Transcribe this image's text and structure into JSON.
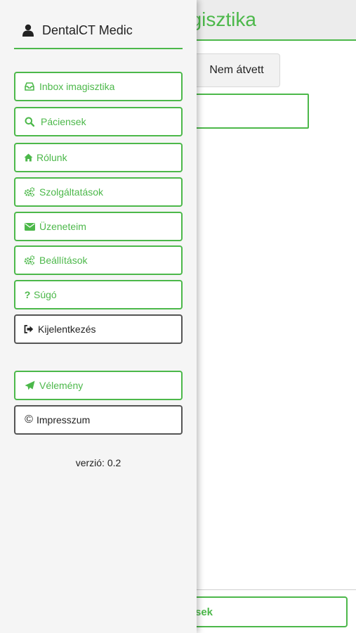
{
  "page": {
    "title_partial": "agisztika",
    "filter_button": "Nem átvett",
    "bottom_button_partial": "sek"
  },
  "drawer": {
    "app_name": "DentalCT Medic",
    "user_icon": "user-icon",
    "menu": [
      {
        "label": "Inbox imagisztika",
        "icon": "inbox-icon"
      },
      {
        "label": "Páciensek",
        "icon": "search-icon"
      },
      {
        "label": "Rólunk",
        "icon": "home-icon"
      },
      {
        "label": "Szolgáltatások",
        "icon": "gears-icon"
      },
      {
        "label": "Üzeneteim",
        "icon": "envelope-icon"
      },
      {
        "label": "Beállítások",
        "icon": "gears-icon"
      },
      {
        "label": "Súgó",
        "icon": "question-icon"
      },
      {
        "label": "Kijelentkezés",
        "icon": "sign-out-icon"
      }
    ],
    "extra": [
      {
        "label": "Vélemény",
        "icon": "paper-plane-icon"
      },
      {
        "label": "Impresszum",
        "icon": "copyright-icon",
        "icon_glyph": "©"
      }
    ],
    "version": "verzió: 0.2"
  },
  "colors": {
    "accent": "#4cb84a",
    "drawer_bg": "#f5f5f5",
    "header_bg": "#ececec",
    "dark_border": "#555555"
  }
}
